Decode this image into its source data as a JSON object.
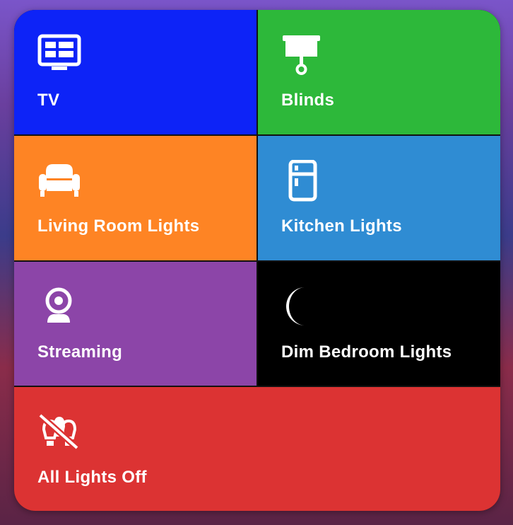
{
  "widget": {
    "tiles": [
      {
        "label": "TV",
        "icon": "tv-icon",
        "color": "#0d23f7"
      },
      {
        "label": "Blinds",
        "icon": "blinds-icon",
        "color": "#2db83a"
      },
      {
        "label": "Living Room Lights",
        "icon": "sofa-icon",
        "color": "#fe8424"
      },
      {
        "label": "Kitchen Lights",
        "icon": "fridge-icon",
        "color": "#2f8cd3"
      },
      {
        "label": "Streaming",
        "icon": "webcam-icon",
        "color": "#8c45a8"
      },
      {
        "label": "Dim Bedroom Lights",
        "icon": "moon-icon",
        "color": "#000000"
      },
      {
        "label": "All Lights Off",
        "icon": "lights-off-icon",
        "color": "#dc3333"
      }
    ]
  }
}
